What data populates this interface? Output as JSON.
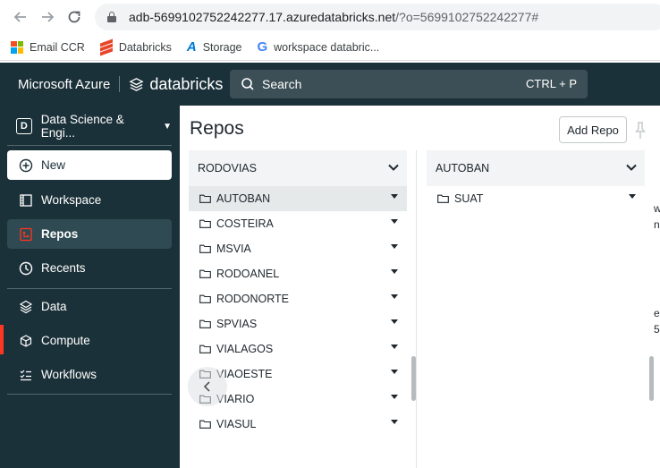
{
  "browser": {
    "url_host": "adb-5699102752242277.17.azuredatabricks.net",
    "url_rest": "/?o=5699102752242277#",
    "bookmarks": [
      {
        "label": "Email CCR",
        "icon": "microsoft-logo"
      },
      {
        "label": "Databricks",
        "icon": "databricks-logo"
      },
      {
        "label": "Storage",
        "icon": "azure-logo"
      },
      {
        "label": "workspace databric...",
        "icon": "google-logo"
      }
    ]
  },
  "topbar": {
    "ms_brand": "Microsoft Azure",
    "db_brand": "databricks",
    "search_label": "Search",
    "search_shortcut": "CTRL + P"
  },
  "sidebar": {
    "persona": "Data Science & Engi...",
    "persona_initial": "D",
    "items": [
      {
        "label": "New",
        "icon": "plus-circle-icon"
      },
      {
        "label": "Workspace",
        "icon": "workspace-icon"
      },
      {
        "label": "Repos",
        "icon": "repos-icon",
        "active": true
      },
      {
        "label": "Recents",
        "icon": "clock-icon"
      },
      {
        "label": "Data",
        "icon": "data-icon"
      },
      {
        "label": "Compute",
        "icon": "cloud-icon"
      },
      {
        "label": "Workflows",
        "icon": "workflows-icon"
      }
    ]
  },
  "main": {
    "title": "Repos",
    "add_repo": "Add Repo",
    "columns": [
      {
        "header": "RODOVIAS",
        "rows": [
          "AUTOBAN",
          "COSTEIRA",
          "MSVIA",
          "RODOANEL",
          "RODONORTE",
          "SPVIAS",
          "VIALAGOS",
          "VIAOESTE",
          "VIARIO",
          "VIASUL"
        ],
        "selected": "AUTOBAN"
      },
      {
        "header": "AUTOBAN",
        "rows": [
          "SUAT"
        ]
      }
    ],
    "edge_fragments": [
      "w",
      "n",
      "es",
      "5"
    ]
  },
  "colors": {
    "sidebar_bg": "#1b3139",
    "accent": "#ff3621",
    "selected_row": "#e6e9ea"
  }
}
